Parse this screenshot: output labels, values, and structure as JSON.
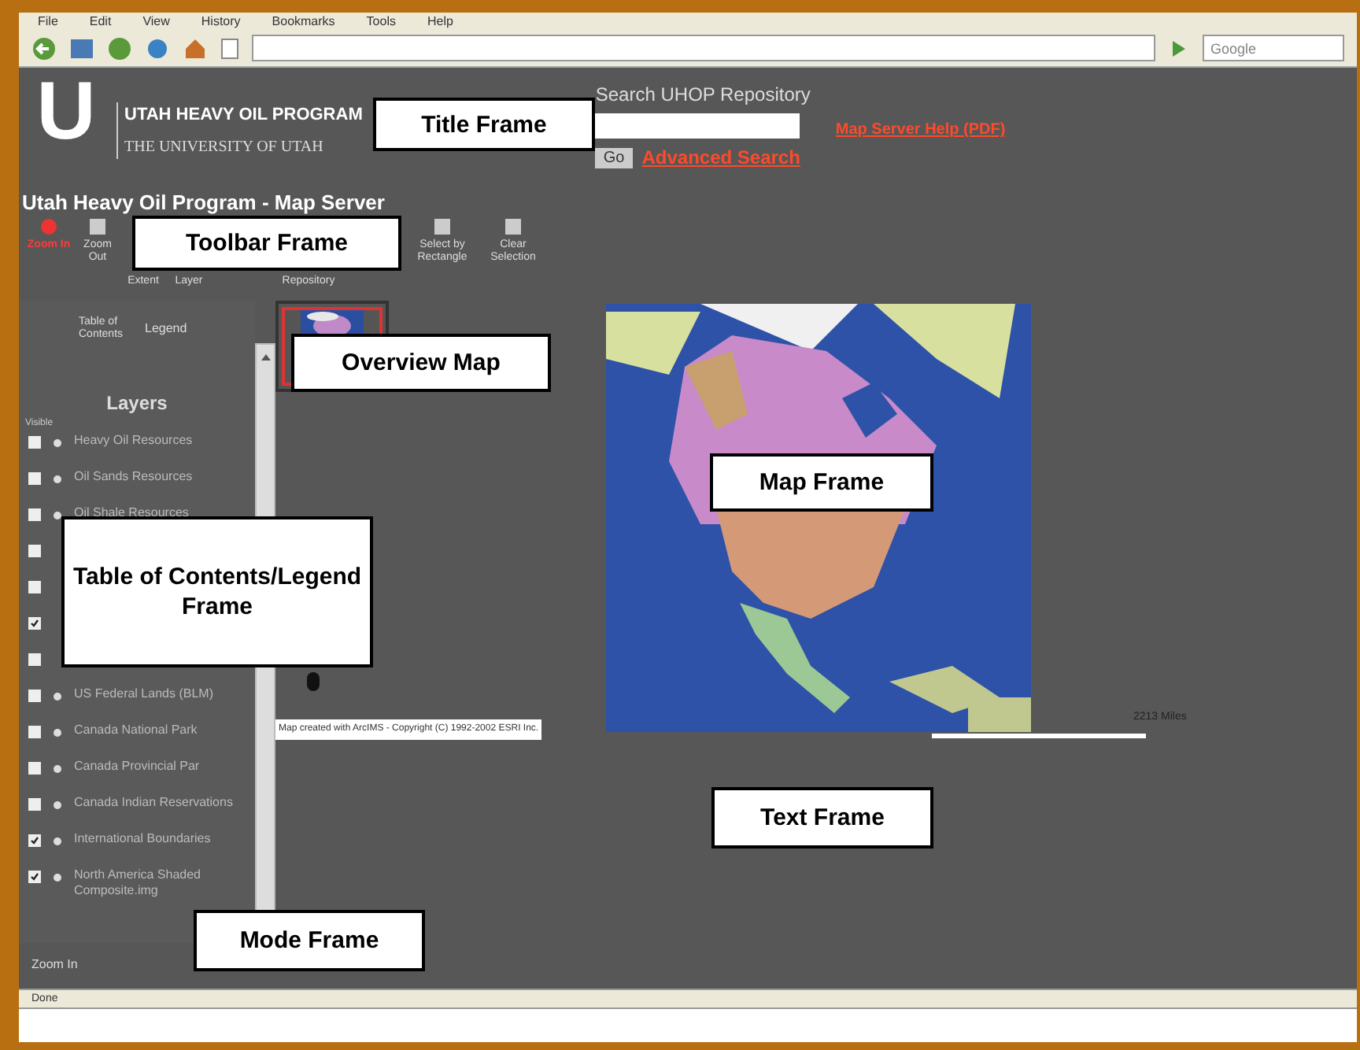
{
  "browser": {
    "menu": [
      "File",
      "Edit",
      "View",
      "History",
      "Bookmarks",
      "Tools",
      "Help"
    ],
    "search_placeholder": "Google"
  },
  "header": {
    "logo_letter": "U",
    "program": "UTAH HEAVY OIL PROGRAM",
    "university": "THE UNIVERSITY OF UTAH",
    "search_label": "Search UHOP Repository",
    "go": "Go",
    "advanced_link": "Advanced Search",
    "help_link": "Map Server Help (PDF)"
  },
  "page_title": "Utah Heavy Oil Program - Map Server",
  "tools": [
    {
      "label": "Zoom In",
      "selected": true
    },
    {
      "label": "Zoom Out",
      "selected": false
    },
    {
      "label": "Extent",
      "selected": false
    },
    {
      "label": "Layer",
      "selected": false
    },
    {
      "label": "Repository",
      "selected": false
    },
    {
      "label": "Select by Rectangle",
      "selected": false
    },
    {
      "label": "Clear Selection",
      "selected": false
    }
  ],
  "panel_tabs": [
    "Table of Contents",
    "Legend"
  ],
  "layers_title": "Layers",
  "visible_label": "Visible",
  "layers": [
    {
      "label": "Heavy Oil Resources",
      "checked": false
    },
    {
      "label": "Oil Sands Resources",
      "checked": false
    },
    {
      "label": "Oil Shale Resources",
      "checked": false
    },
    {
      "checked": false
    },
    {
      "checked": false
    },
    {
      "checked": true
    },
    {
      "checked": false
    },
    {
      "label": "US Federal Lands (BLM)",
      "checked": false
    },
    {
      "label": "Canada National Park",
      "checked": false
    },
    {
      "label": "Canada Provincial Par",
      "checked": false
    },
    {
      "label": "Canada Indian Reservations",
      "checked": false
    },
    {
      "label": "International Boundaries",
      "checked": true
    },
    {
      "label": "North America Shaded Composite.img",
      "checked": true
    }
  ],
  "map": {
    "copyright": "Map created with ArcIMS - Copyright (C) 1992-2002 ESRI Inc.",
    "scale": "2213 Miles"
  },
  "mode": "Zoom In",
  "status": "Done",
  "callouts": [
    "Title Frame",
    "Toolbar Frame",
    "Overview Map",
    "Table of Contents/Legend Frame",
    "Map Frame",
    "Text Frame",
    "Mode Frame"
  ]
}
